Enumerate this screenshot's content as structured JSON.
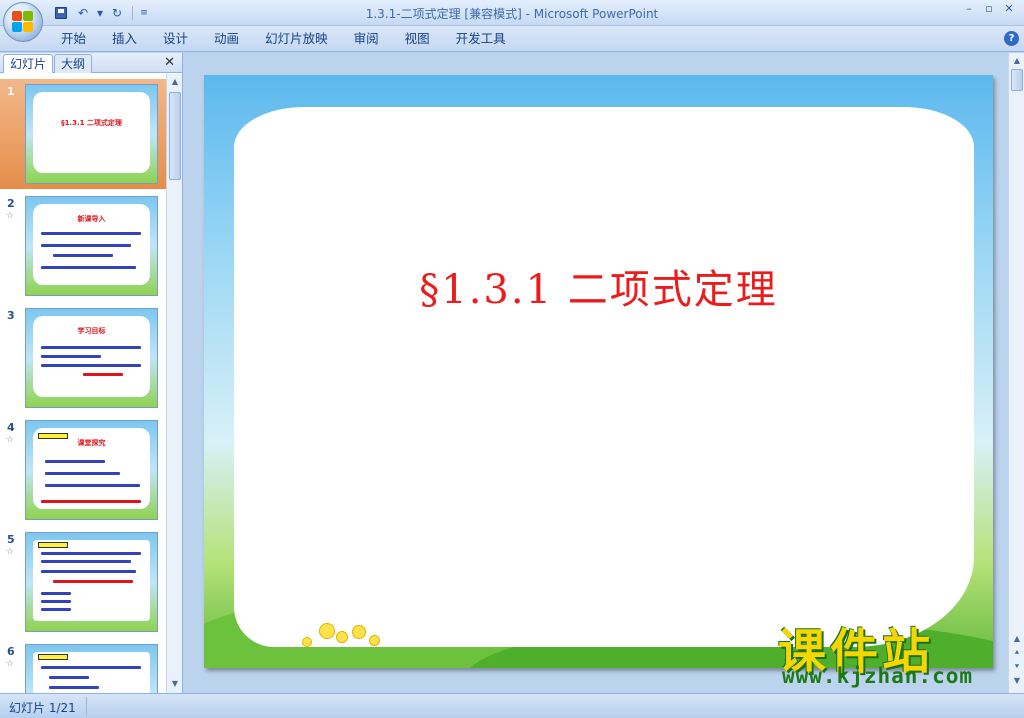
{
  "window": {
    "title": "1.3.1-二项式定理 [兼容模式]",
    "title_sep": " - ",
    "app_name": "Microsoft PowerPoint",
    "minimize": "–",
    "restore": "▫",
    "close": "✕"
  },
  "qat": {
    "undo": "↶",
    "redo": "↻",
    "dropdown": "▾",
    "customize": "≡"
  },
  "ribbon": {
    "tabs": [
      "开始",
      "插入",
      "设计",
      "动画",
      "幻灯片放映",
      "审阅",
      "视图",
      "开发工具"
    ],
    "help": "?"
  },
  "left_pane": {
    "tab_slides": "幻灯片",
    "tab_outline": "大纲",
    "close": "✕",
    "thumbnails": [
      {
        "num": "1",
        "title": "§1.3.1 二项式定理"
      },
      {
        "num": "2",
        "title": "新课导入"
      },
      {
        "num": "3",
        "title": "学习目标"
      },
      {
        "num": "4",
        "title": "课堂探究"
      },
      {
        "num": "5",
        "title": ""
      },
      {
        "num": "6",
        "title": ""
      }
    ],
    "star": "☆"
  },
  "slide": {
    "title": "§1.3.1  二项式定理"
  },
  "watermark": {
    "main": "课件站",
    "url": "www.kjzhan.com"
  },
  "status": {
    "slide_info": "幻灯片 1/21"
  },
  "colors": {
    "title_red": "#ea1c1c",
    "accent_blue": "#15428b",
    "selected_orange": "#e58e4a"
  }
}
